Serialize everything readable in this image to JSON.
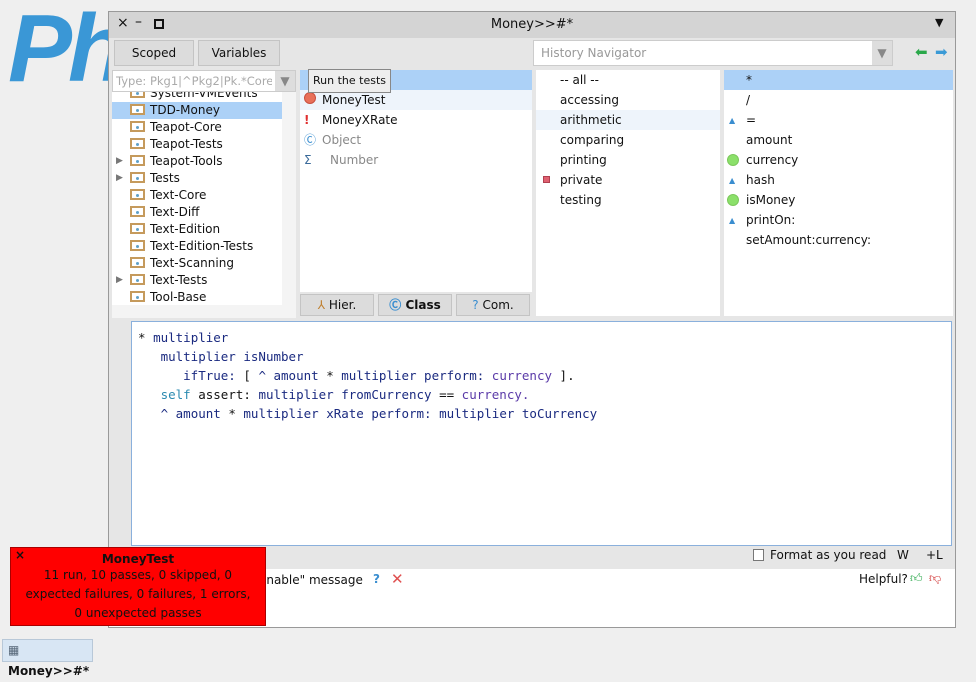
{
  "logo": "Ph",
  "window": {
    "title": "Money>>#*"
  },
  "toolbar": {
    "scoped": "Scoped",
    "variables": "Variables",
    "history_placeholder": "History Navigator"
  },
  "packages": {
    "filter_placeholder": "Type: Pkg1|^Pkg2|Pk.*Core$",
    "items": [
      {
        "label": "System-VMEvents",
        "expand": false
      },
      {
        "label": "TDD-Money",
        "expand": false,
        "selected": true
      },
      {
        "label": "Teapot-Core",
        "expand": false
      },
      {
        "label": "Teapot-Tests",
        "expand": false
      },
      {
        "label": "Teapot-Tools",
        "expand": true
      },
      {
        "label": "Tests",
        "expand": true
      },
      {
        "label": "Text-Core",
        "expand": false
      },
      {
        "label": "Text-Diff",
        "expand": false
      },
      {
        "label": "Text-Edition",
        "expand": false
      },
      {
        "label": "Text-Edition-Tests",
        "expand": false
      },
      {
        "label": "Text-Scanning",
        "expand": false
      },
      {
        "label": "Text-Tests",
        "expand": true
      },
      {
        "label": "Tool-Base",
        "expand": false
      }
    ]
  },
  "classes": {
    "tooltip": "Run the tests",
    "items": [
      {
        "label": "MoneyTest",
        "icon": "red-circle"
      },
      {
        "label": "MoneyXRate",
        "icon": "exclamation"
      },
      {
        "label": "Object",
        "icon": "class-c"
      },
      {
        "label": "Number",
        "icon": "sigma"
      }
    ],
    "tabs": {
      "hier": "Hier.",
      "class": "Class",
      "com": "Com."
    }
  },
  "protocols": [
    "-- all --",
    "accessing",
    "arithmetic",
    "comparing",
    "printing",
    "private",
    "testing"
  ],
  "methods": [
    {
      "label": "*",
      "icon": ""
    },
    {
      "label": "/",
      "icon": ""
    },
    {
      "label": "=",
      "icon": "up-triangle"
    },
    {
      "label": "amount",
      "icon": ""
    },
    {
      "label": "currency",
      "icon": "green-dot"
    },
    {
      "label": "hash",
      "icon": "up-triangle"
    },
    {
      "label": "isMoney",
      "icon": "green-dot"
    },
    {
      "label": "printOn:",
      "icon": "up-triangle"
    },
    {
      "label": "setAmount:currency:",
      "icon": ""
    }
  ],
  "code": [
    "* multiplier",
    "   multiplier isNumber",
    "      ifTrue: [ ^ amount * multiplier perform: currency ].",
    "   self assert: multiplier fromCurrency == currency.",
    "   ^ amount * multiplier xRate perform: multiplier toCurrency"
  ],
  "status": {
    "format": "Format as you read",
    "w": "W",
    "l": "+L"
  },
  "help": {
    "text": "onable\" message",
    "q": "?",
    "helpful": "Helpful?"
  },
  "popup": {
    "title": "MoneyTest",
    "body": "11 run, 10 passes, 0 skipped, 0 expected failures, 0 failures, 1 errors, 0 unexpected passes",
    "close": "×",
    "color": "#ff0000"
  },
  "taskbar": {
    "label": "Money>>#*"
  }
}
